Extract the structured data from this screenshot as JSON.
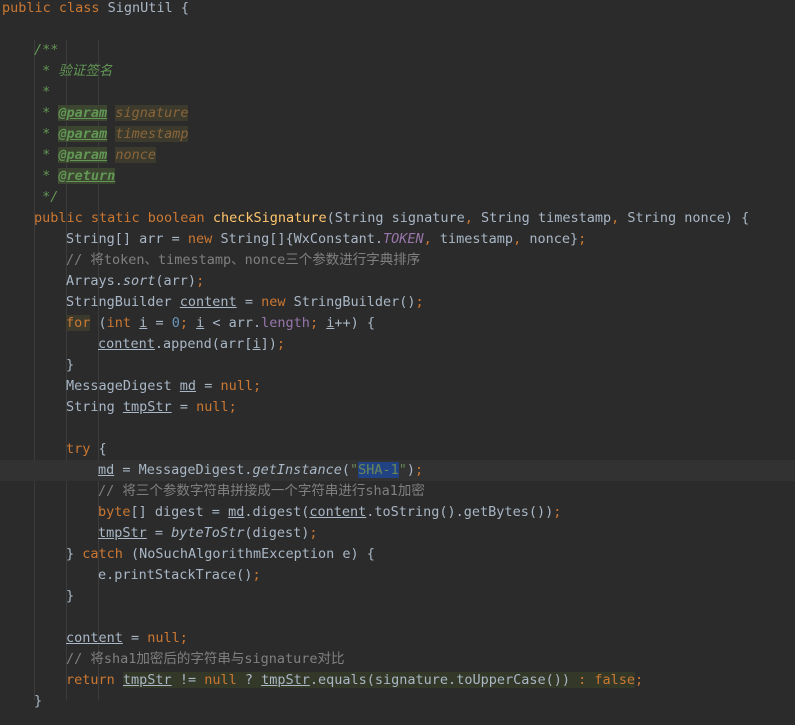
{
  "editor": {
    "language": "java",
    "colors": {
      "background": "#2b2b2b",
      "keyword": "#cc7832",
      "comment": "#808080",
      "javadoc": "#629755",
      "string": "#6a8759",
      "number": "#6897bb",
      "method_decl": "#ffc66d",
      "field": "#9876aa",
      "plain": "#a9b7c6",
      "selection": "#214283"
    },
    "lines": [
      {
        "indent": 0,
        "tokens": [
          [
            "kw",
            "public class "
          ],
          [
            "",
            "SignUtil {"
          ]
        ]
      },
      {
        "indent": 0,
        "tokens": []
      },
      {
        "indent": 1,
        "tokens": [
          [
            "jd",
            "/**"
          ]
        ]
      },
      {
        "indent": 1,
        "tokens": [
          [
            "jd",
            " * 验证签名"
          ]
        ]
      },
      {
        "indent": 1,
        "tokens": [
          [
            "jd",
            " *"
          ]
        ]
      },
      {
        "indent": 1,
        "tokens": [
          [
            "jd",
            " * "
          ],
          [
            "jdtag",
            "@param"
          ],
          [
            "jd",
            " "
          ],
          [
            "jdval",
            "signature"
          ]
        ]
      },
      {
        "indent": 1,
        "tokens": [
          [
            "jd",
            " * "
          ],
          [
            "jdtag",
            "@param"
          ],
          [
            "jd",
            " "
          ],
          [
            "jdval",
            "timestamp"
          ]
        ]
      },
      {
        "indent": 1,
        "tokens": [
          [
            "jd",
            " * "
          ],
          [
            "jdtag",
            "@param"
          ],
          [
            "jd",
            " "
          ],
          [
            "jdval",
            "nonce"
          ]
        ]
      },
      {
        "indent": 1,
        "tokens": [
          [
            "jd",
            " * "
          ],
          [
            "jdtag",
            "@return"
          ]
        ]
      },
      {
        "indent": 1,
        "tokens": [
          [
            "jd",
            " */"
          ]
        ]
      },
      {
        "indent": 1,
        "tokens": [
          [
            "kw",
            "public static boolean "
          ],
          [
            "fn",
            "checkSignature"
          ],
          [
            "",
            "(String signature"
          ],
          [
            "kw",
            ", "
          ],
          [
            "",
            "String timestamp"
          ],
          [
            "kw",
            ", "
          ],
          [
            "",
            "String nonce) {"
          ]
        ]
      },
      {
        "indent": 2,
        "tokens": [
          [
            "",
            "String[] arr = "
          ],
          [
            "kw",
            "new "
          ],
          [
            "",
            "String[]{WxConstant."
          ],
          [
            "fieldi",
            "TOKEN"
          ],
          [
            "kw",
            ", "
          ],
          [
            "",
            "timestamp"
          ],
          [
            "kw",
            ", "
          ],
          [
            "",
            "nonce}"
          ],
          [
            "kw",
            ";"
          ]
        ]
      },
      {
        "indent": 2,
        "tokens": [
          [
            "cm",
            "// 将token、timestamp、nonce三个参数进行字典排序"
          ]
        ]
      },
      {
        "indent": 2,
        "tokens": [
          [
            "",
            "Arrays."
          ],
          [
            "it",
            "sort"
          ],
          [
            "",
            "(arr)"
          ],
          [
            "kw",
            ";"
          ]
        ]
      },
      {
        "indent": 2,
        "tokens": [
          [
            "",
            "StringBuilder "
          ],
          [
            "ul",
            "content"
          ],
          [
            "",
            " = "
          ],
          [
            "kw",
            "new "
          ],
          [
            "",
            "StringBuilder()"
          ],
          [
            "kw",
            ";"
          ]
        ]
      },
      {
        "indent": 2,
        "tokens": [
          [
            "kw hl",
            "for"
          ],
          [
            "",
            " ("
          ],
          [
            "kw",
            "int "
          ],
          [
            "ul",
            "i"
          ],
          [
            "",
            " = "
          ],
          [
            "num",
            "0"
          ],
          [
            "kw",
            "; "
          ],
          [
            "ul",
            "i"
          ],
          [
            "",
            " < arr."
          ],
          [
            "field",
            "length"
          ],
          [
            "kw",
            "; "
          ],
          [
            "ul",
            "i"
          ],
          [
            "",
            "++) {"
          ]
        ]
      },
      {
        "indent": 3,
        "tokens": [
          [
            "ul",
            "content"
          ],
          [
            "",
            ".append(arr["
          ],
          [
            "ul",
            "i"
          ],
          [
            "",
            "])"
          ],
          [
            "kw",
            ";"
          ]
        ]
      },
      {
        "indent": 2,
        "tokens": [
          [
            "",
            "}"
          ]
        ]
      },
      {
        "indent": 2,
        "tokens": [
          [
            "",
            "MessageDigest "
          ],
          [
            "ul",
            "md"
          ],
          [
            "",
            " = "
          ],
          [
            "kw",
            "null;"
          ]
        ]
      },
      {
        "indent": 2,
        "tokens": [
          [
            "",
            "String "
          ],
          [
            "ul",
            "tmpStr"
          ],
          [
            "",
            " = "
          ],
          [
            "kw",
            "null;"
          ]
        ]
      },
      {
        "indent": 0,
        "tokens": []
      },
      {
        "indent": 2,
        "tokens": [
          [
            "kw",
            "try "
          ],
          [
            "",
            "{"
          ]
        ]
      },
      {
        "indent": 3,
        "current": true,
        "tokens": [
          [
            "ul",
            "md"
          ],
          [
            "",
            " = MessageDigest."
          ],
          [
            "it",
            "getInstance"
          ],
          [
            "",
            "("
          ],
          [
            "str",
            "\""
          ],
          [
            "strsel",
            "SHA-1"
          ],
          [
            "str",
            "\""
          ],
          [
            "",
            ")"
          ],
          [
            "kw",
            ";"
          ]
        ]
      },
      {
        "indent": 3,
        "tokens": [
          [
            "cm",
            "// 将三个参数字符串拼接成一个字符串进行sha1加密"
          ]
        ]
      },
      {
        "indent": 3,
        "tokens": [
          [
            "kw",
            "byte"
          ],
          [
            "",
            "[] digest = "
          ],
          [
            "ul",
            "md"
          ],
          [
            "",
            ".digest("
          ],
          [
            "ul",
            "content"
          ],
          [
            "",
            ".toString().getBytes())"
          ],
          [
            "kw",
            ";"
          ]
        ]
      },
      {
        "indent": 3,
        "tokens": [
          [
            "ul",
            "tmpStr"
          ],
          [
            "",
            " = "
          ],
          [
            "it",
            "byteToStr"
          ],
          [
            "",
            "(digest)"
          ],
          [
            "kw",
            ";"
          ]
        ]
      },
      {
        "indent": 2,
        "tokens": [
          [
            "",
            "} "
          ],
          [
            "kw",
            "catch "
          ],
          [
            "",
            "(NoSuchAlgorithmException e) {"
          ]
        ]
      },
      {
        "indent": 3,
        "tokens": [
          [
            "",
            "e.printStackTrace()"
          ],
          [
            "kw",
            ";"
          ]
        ]
      },
      {
        "indent": 2,
        "tokens": [
          [
            "",
            "}"
          ]
        ]
      },
      {
        "indent": 0,
        "tokens": []
      },
      {
        "indent": 2,
        "tokens": [
          [
            "ul",
            "content"
          ],
          [
            "",
            " = "
          ],
          [
            "kw",
            "null;"
          ]
        ]
      },
      {
        "indent": 2,
        "tokens": [
          [
            "cm",
            "// 将sha1加密后的字符串与signature对比"
          ]
        ]
      },
      {
        "indent": 2,
        "tokens": [
          [
            "kw",
            "return "
          ],
          [
            "ul retline",
            "tmpStr"
          ],
          [
            "retline",
            " != "
          ],
          [
            "kw retline",
            "null "
          ],
          [
            "retline",
            "? "
          ],
          [
            "ul retline",
            "tmpStr"
          ],
          [
            "retline",
            ".equals(signature.toUpperCase()) "
          ],
          [
            "kw retline",
            ": false"
          ],
          [
            "kw",
            ";"
          ]
        ]
      },
      {
        "indent": 1,
        "tokens": [
          [
            "",
            "}"
          ]
        ]
      }
    ]
  }
}
